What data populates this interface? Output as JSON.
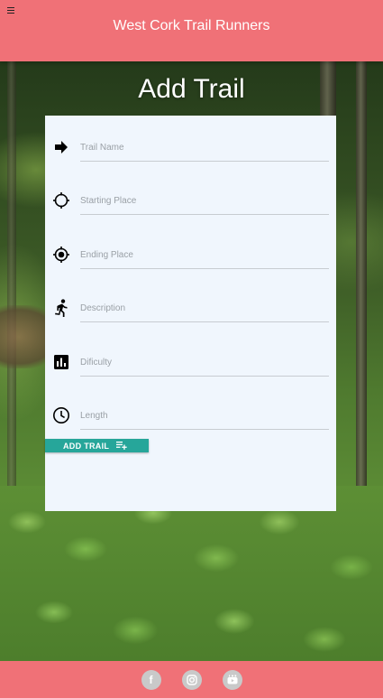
{
  "header": {
    "title": "West Cork Trail Runners",
    "menu_icon": "hamburger-menu-icon"
  },
  "page": {
    "title": "Add Trail"
  },
  "form": {
    "fields": [
      {
        "name": "trail-name",
        "placeholder": "Trail Name",
        "value": "",
        "icon": "arrow-right-icon"
      },
      {
        "name": "starting-place",
        "placeholder": "Starting Place",
        "value": "",
        "icon": "crosshair-icon"
      },
      {
        "name": "ending-place",
        "placeholder": "Ending Place",
        "value": "",
        "icon": "gps-fixed-icon"
      },
      {
        "name": "description",
        "placeholder": "Description",
        "value": "",
        "icon": "runner-icon"
      },
      {
        "name": "difficulty",
        "placeholder": "Dificulty",
        "value": "",
        "icon": "bar-chart-icon"
      },
      {
        "name": "length",
        "placeholder": "Length",
        "value": "",
        "icon": "clock-icon"
      }
    ],
    "submit_label": "ADD TRAIL",
    "submit_icon": "playlist-add-icon"
  },
  "footer": {
    "social": [
      {
        "name": "facebook-icon",
        "glyph": "f"
      },
      {
        "name": "instagram-icon",
        "glyph": ""
      },
      {
        "name": "youtube-icon",
        "glyph": ""
      }
    ]
  },
  "colors": {
    "header": "#f07177",
    "card": "#f0f6fd",
    "button": "#26a69a"
  }
}
